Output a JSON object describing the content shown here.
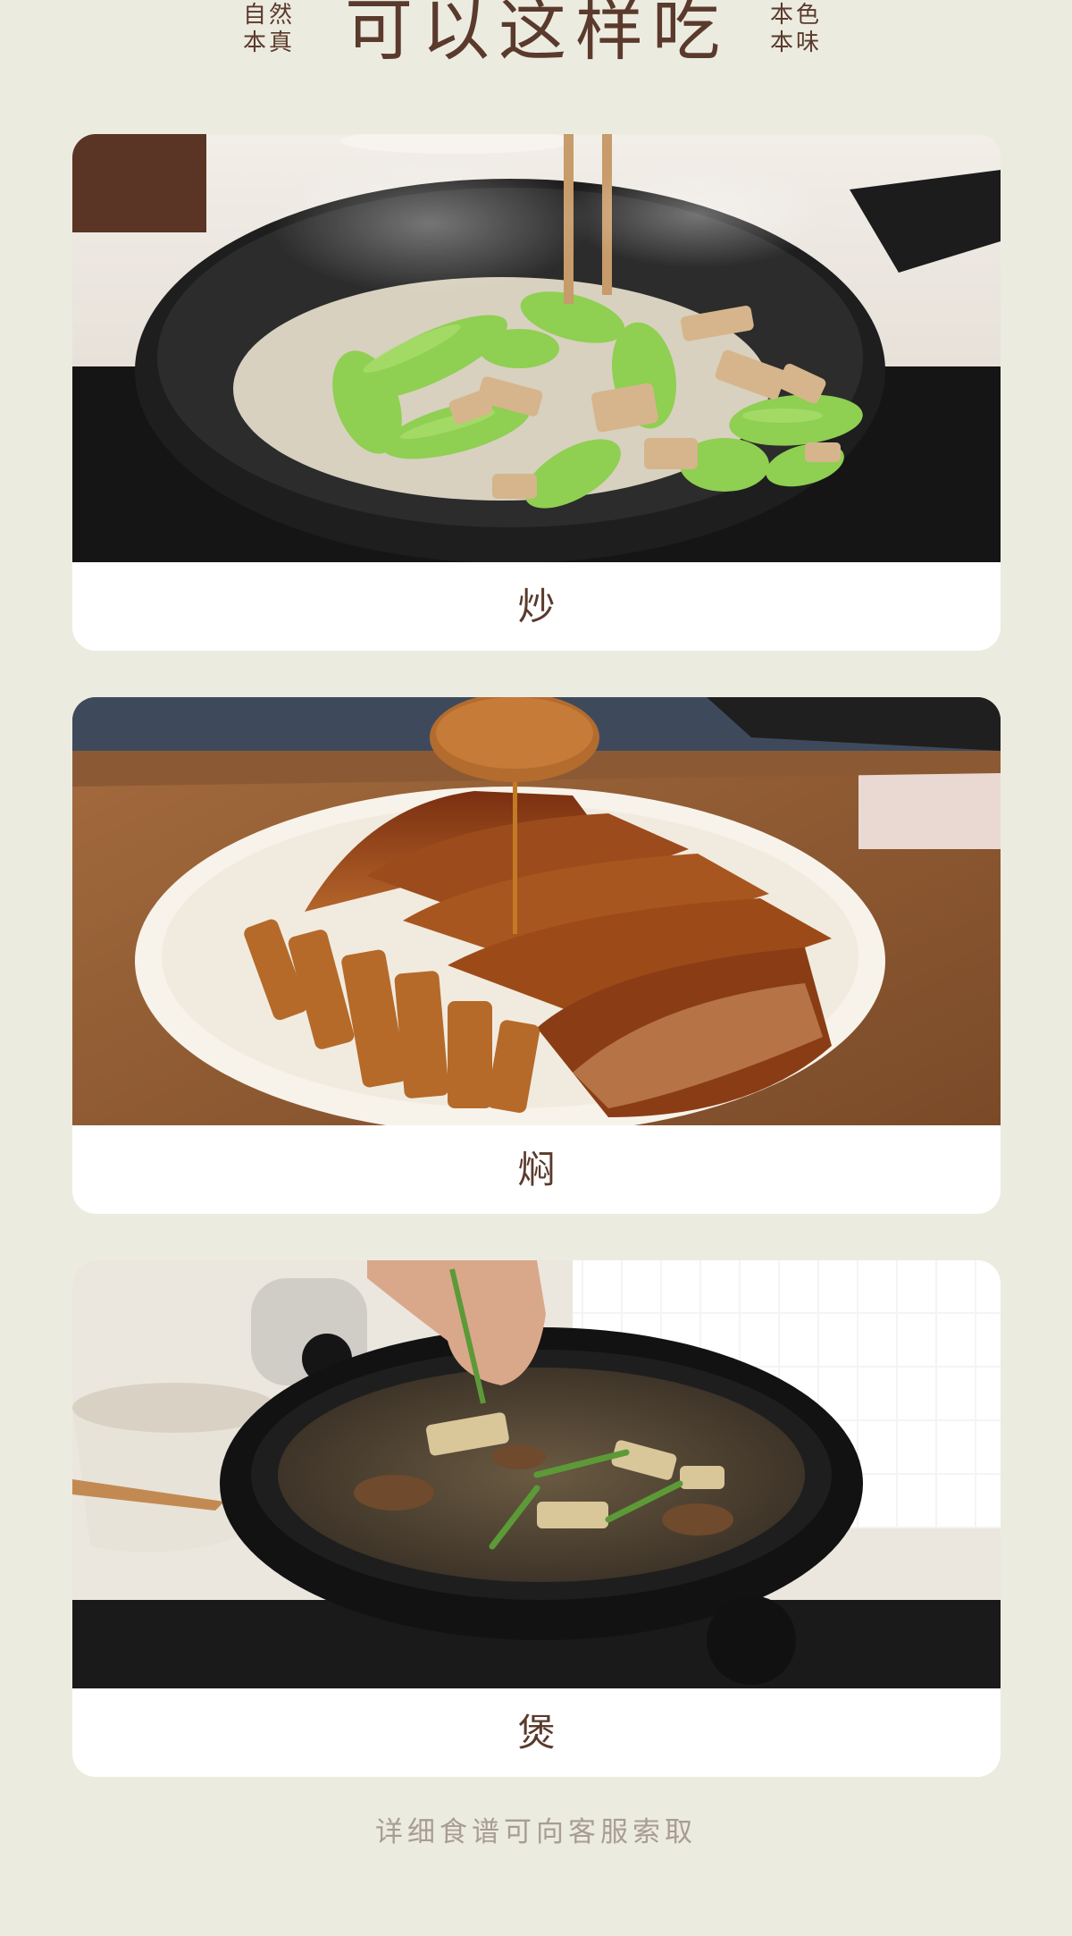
{
  "header": {
    "left_note": [
      "自然",
      "本真"
    ],
    "title": "可以这样吃",
    "right_note": [
      "本色",
      "本味"
    ]
  },
  "cards": [
    {
      "label": "炒",
      "image": "stir-fried-bamboo-shoots-with-green-peppers-in-pan"
    },
    {
      "label": "焖",
      "image": "braised-pork-belly-with-bamboo-shoots-in-bowl"
    },
    {
      "label": "煲",
      "image": "bamboo-shoot-soup-in-claypot"
    }
  ],
  "footer": {
    "note": "详细食谱可向客服索取"
  },
  "colors": {
    "background": "#ecebe0",
    "title_text": "#5a3a2c",
    "card": "#ffffff",
    "footer_text": "#a79d94"
  }
}
